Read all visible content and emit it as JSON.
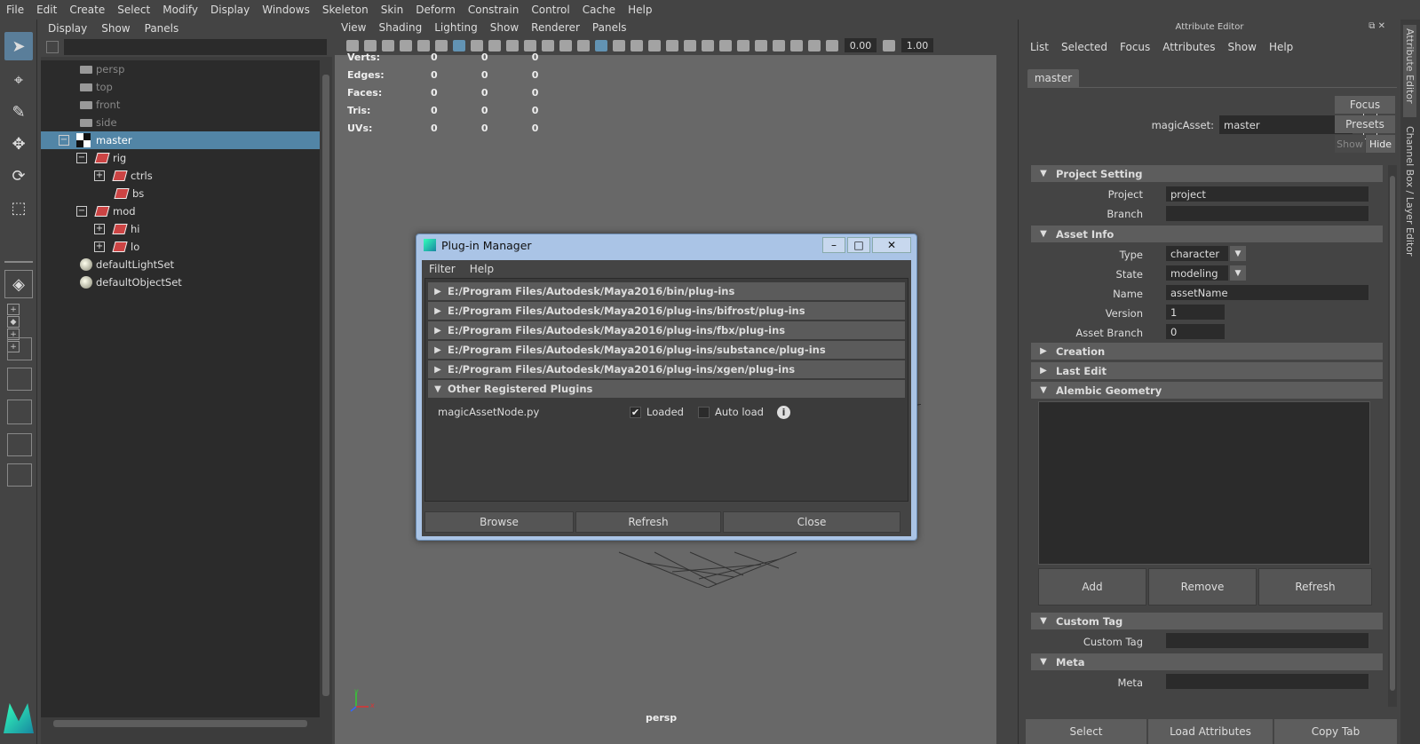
{
  "menubar": [
    "File",
    "Edit",
    "Create",
    "Select",
    "Modify",
    "Display",
    "Windows",
    "Skeleton",
    "Skin",
    "Deform",
    "Constrain",
    "Control",
    "Cache",
    "Help"
  ],
  "outliner": {
    "menu": [
      "Display",
      "Show",
      "Panels"
    ],
    "items": [
      {
        "label": "persp",
        "type": "camera",
        "dim": true
      },
      {
        "label": "top",
        "type": "camera",
        "dim": true
      },
      {
        "label": "front",
        "type": "camera",
        "dim": true
      },
      {
        "label": "side",
        "type": "camera",
        "dim": true
      },
      {
        "label": "master",
        "type": "asset",
        "selected": true
      },
      {
        "label": "rig",
        "type": "transform"
      },
      {
        "label": "ctrls",
        "type": "transform"
      },
      {
        "label": "bs",
        "type": "transform"
      },
      {
        "label": "mod",
        "type": "transform"
      },
      {
        "label": "hi",
        "type": "transform"
      },
      {
        "label": "lo",
        "type": "transform"
      },
      {
        "label": "defaultLightSet",
        "type": "set"
      },
      {
        "label": "defaultObjectSet",
        "type": "set"
      }
    ]
  },
  "viewport": {
    "menu": [
      "View",
      "Shading",
      "Lighting",
      "Show",
      "Renderer",
      "Panels"
    ],
    "field_a": "0.00",
    "field_b": "1.00",
    "hud": [
      {
        "label": "Verts:",
        "v": [
          "0",
          "0",
          "0"
        ]
      },
      {
        "label": "Edges:",
        "v": [
          "0",
          "0",
          "0"
        ]
      },
      {
        "label": "Faces:",
        "v": [
          "0",
          "0",
          "0"
        ]
      },
      {
        "label": "Tris:",
        "v": [
          "0",
          "0",
          "0"
        ]
      },
      {
        "label": "UVs:",
        "v": [
          "0",
          "0",
          "0"
        ]
      }
    ],
    "camera_label": "persp",
    "axis_x": "x",
    "axis_y": "y"
  },
  "plugin_manager": {
    "title": "Plug-in Manager",
    "menu": [
      "Filter",
      "Help"
    ],
    "paths": [
      "E:/Program Files/Autodesk/Maya2016/bin/plug-ins",
      "E:/Program Files/Autodesk/Maya2016/plug-ins/bifrost/plug-ins",
      "E:/Program Files/Autodesk/Maya2016/plug-ins/fbx/plug-ins",
      "E:/Program Files/Autodesk/Maya2016/plug-ins/substance/plug-ins",
      "E:/Program Files/Autodesk/Maya2016/plug-ins/xgen/plug-ins"
    ],
    "other_label": "Other Registered Plugins",
    "plugin_name": "magicAssetNode.py",
    "loaded_label": "Loaded",
    "loaded_checked": true,
    "autoload_label": "Auto load",
    "autoload_checked": false,
    "buttons": {
      "browse": "Browse",
      "refresh": "Refresh",
      "close": "Close"
    }
  },
  "attribute_editor": {
    "title": "Attribute Editor",
    "menu": [
      "List",
      "Selected",
      "Focus",
      "Attributes",
      "Show",
      "Help"
    ],
    "tab": "master",
    "node_type_label": "magicAsset:",
    "node_name": "master",
    "focus": "Focus",
    "presets": "Presets",
    "show": "Show",
    "hide": "Hide",
    "sections": {
      "project_setting": "Project Setting",
      "asset_info": "Asset Info",
      "creation": "Creation",
      "last_edit": "Last Edit",
      "alembic": "Alembic Geometry",
      "custom_tag": "Custom Tag",
      "meta": "Meta"
    },
    "fields": {
      "project_label": "Project",
      "project_value": "project",
      "branch_label": "Branch",
      "branch_value": "",
      "type_label": "Type",
      "type_value": "character",
      "state_label": "State",
      "state_value": "modeling",
      "name_label": "Name",
      "name_value": "assetName",
      "version_label": "Version",
      "version_value": "1",
      "asset_branch_label": "Asset Branch",
      "asset_branch_value": "0",
      "custom_tag_label": "Custom Tag",
      "custom_tag_value": "",
      "meta_label": "Meta",
      "meta_value": ""
    },
    "alembic_buttons": {
      "add": "Add",
      "remove": "Remove",
      "refresh": "Refresh"
    },
    "bottom_buttons": {
      "select": "Select",
      "load": "Load Attributes",
      "copy": "Copy Tab"
    }
  },
  "side_tabs": [
    "Attribute Editor",
    "Channel Box / Layer Editor"
  ]
}
